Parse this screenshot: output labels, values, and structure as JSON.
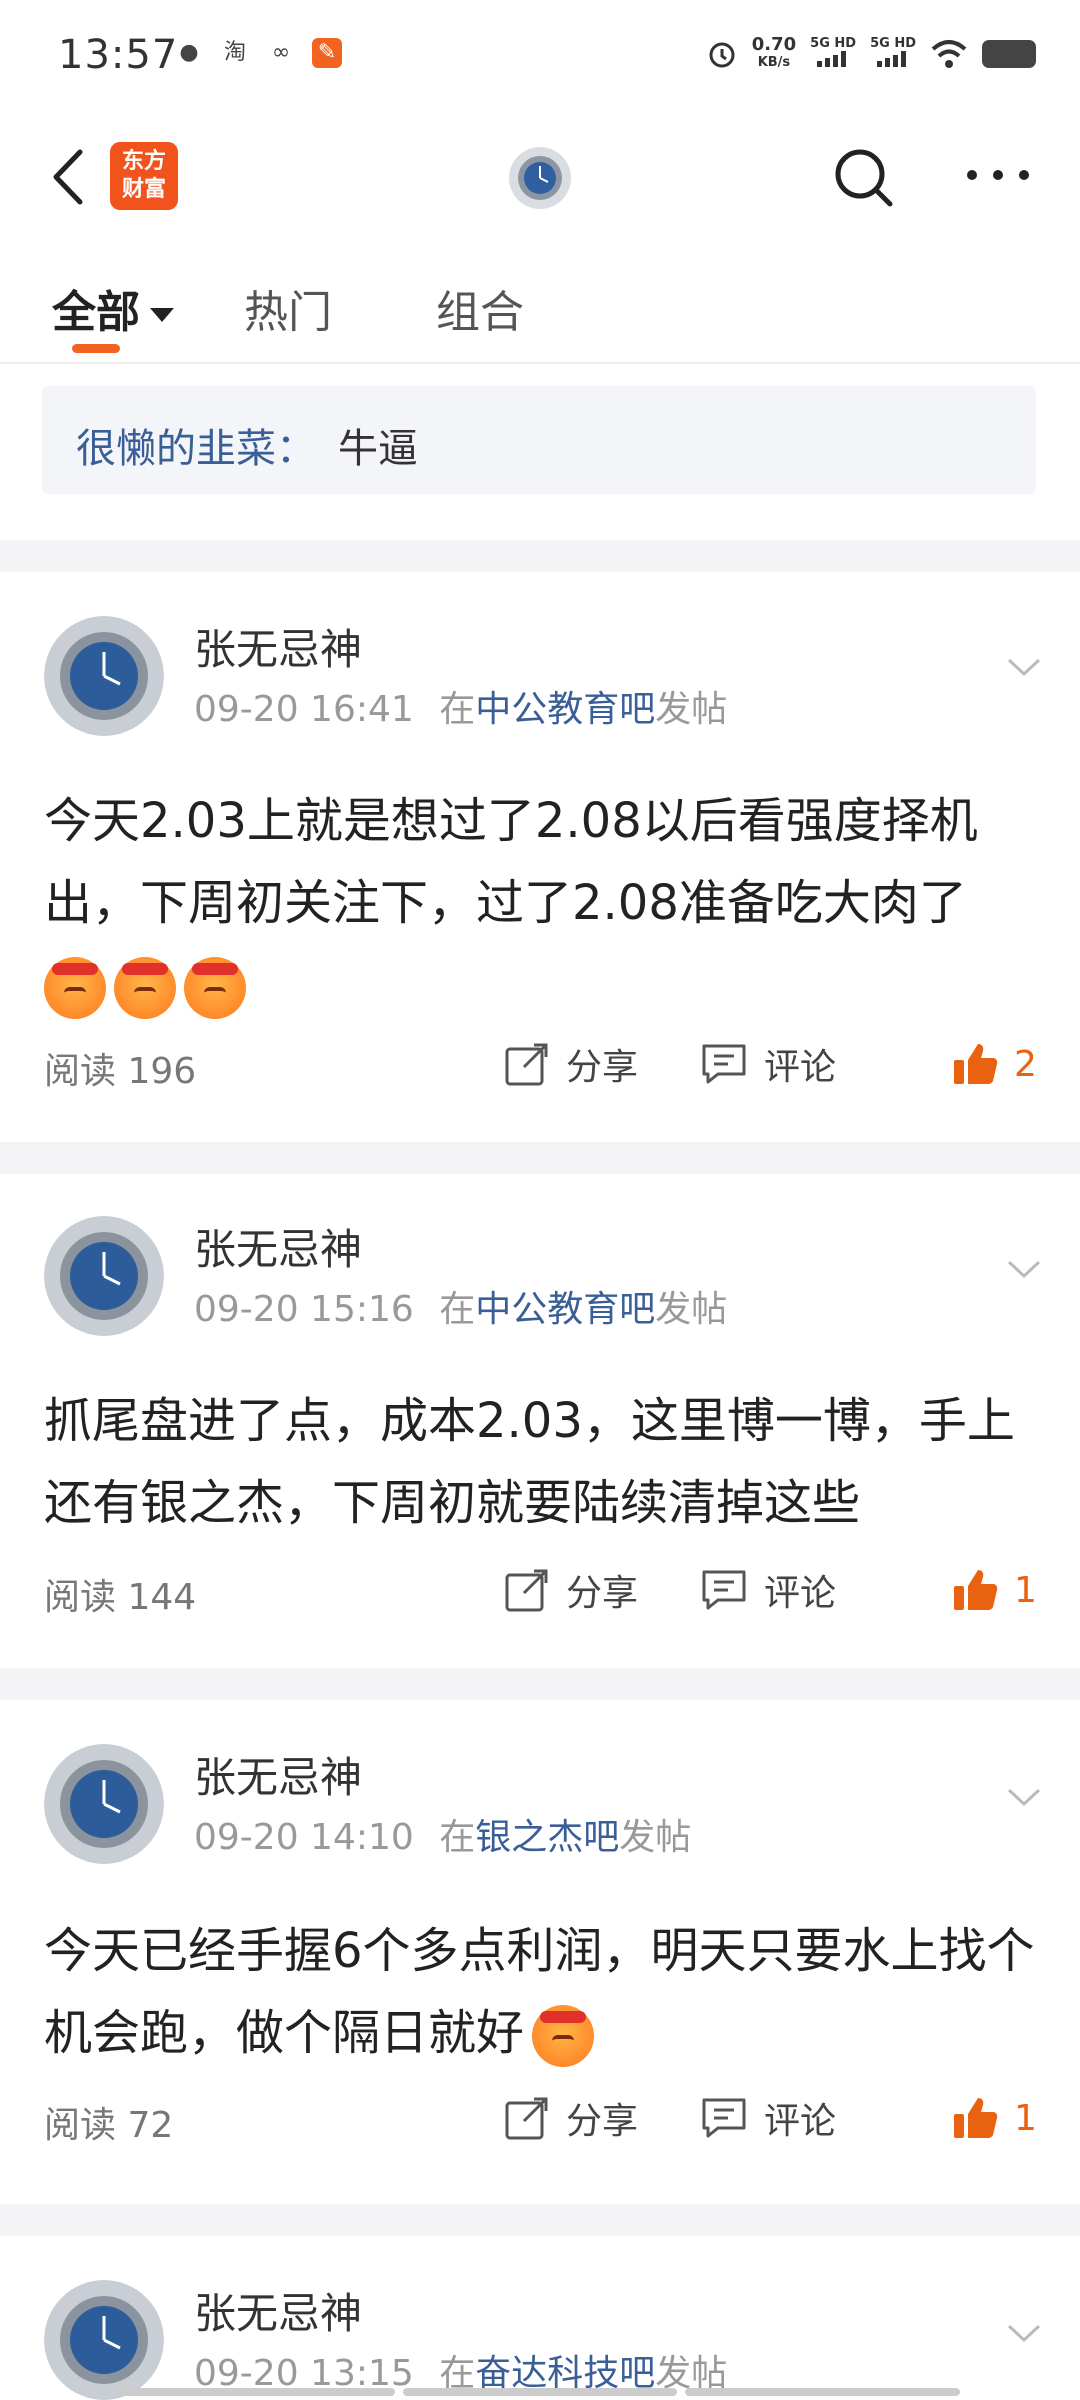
{
  "status_bar": {
    "time": "13:57",
    "speed_value": "0.70",
    "speed_unit": "KB/s",
    "net1": "5G HD",
    "net2": "5G HD"
  },
  "header": {
    "logo_line1": "东方",
    "logo_line2": "财富"
  },
  "tabs": [
    {
      "label": "全部"
    },
    {
      "label": "热门"
    },
    {
      "label": "组合"
    }
  ],
  "quote": {
    "user": "很懒的韭菜：",
    "text": "牛逼"
  },
  "posts": [
    {
      "author": "张无忌神",
      "time": "09-20 16:41",
      "in": "在",
      "bar": "中公教育吧",
      "suffix": "发帖",
      "content": "今天2.03上就是想过了2.08以后看强度择机出，下周初关注下，过了2.08准备吃大肉了",
      "emoji_count": 3,
      "reads": "阅读 196",
      "share": "分享",
      "comment": "评论",
      "likes": "2"
    },
    {
      "author": "张无忌神",
      "time": "09-20 15:16",
      "in": "在",
      "bar": "中公教育吧",
      "suffix": "发帖",
      "content": "抓尾盘进了点，成本2.03，这里博一博，手上还有银之杰，下周初就要陆续清掉这些",
      "emoji_count": 0,
      "reads": "阅读 144",
      "share": "分享",
      "comment": "评论",
      "likes": "1"
    },
    {
      "author": "张无忌神",
      "time": "09-20 14:10",
      "in": "在",
      "bar": "银之杰吧",
      "suffix": "发帖",
      "content": "今天已经手握6个多点利润，明天只要水上找个机会跑，做个隔日就好",
      "emoji_count": 1,
      "reads": "阅读 72",
      "share": "分享",
      "comment": "评论",
      "likes": "1"
    },
    {
      "author": "张无忌神",
      "time": "09-20 13:15",
      "in": "在",
      "bar": "奋达科技吧",
      "suffix": "发帖"
    }
  ],
  "colors": {
    "accent": "#f26321",
    "link": "#3a5f96",
    "like": "#e8620f"
  }
}
